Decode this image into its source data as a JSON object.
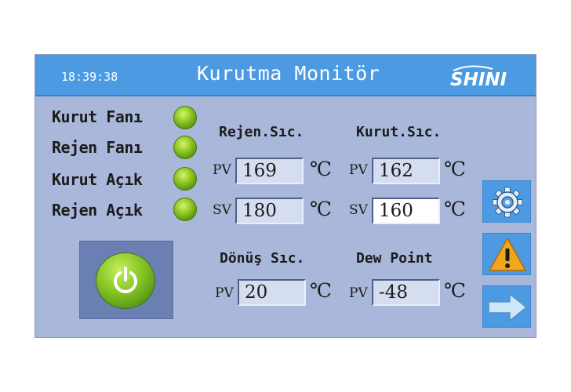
{
  "header": {
    "time": "18:39:38",
    "title": "Kurutma Monitör",
    "logo_text": "SHINI"
  },
  "status": [
    {
      "label": "Kurut Fanı",
      "state": "on",
      "color": "#8cc621"
    },
    {
      "label": "Rejen Fanı",
      "state": "on",
      "color": "#8cc621"
    },
    {
      "label": "Kurut Açık",
      "state": "on",
      "color": "#8cc621"
    },
    {
      "label": "Rejen Açık",
      "state": "on",
      "color": "#8cc621"
    }
  ],
  "sections": {
    "rejen": {
      "title": "Rejen.Sıc.",
      "pv_label": "PV",
      "pv": "169",
      "sv_label": "SV",
      "sv": "180",
      "unit": "℃"
    },
    "kurut": {
      "title": "Kurut.Sıc.",
      "pv_label": "PV",
      "pv": "162",
      "sv_label": "SV",
      "sv": "160",
      "unit": "℃"
    },
    "donus": {
      "title": "Dönüş Sıc.",
      "pv_label": "PV",
      "pv": "20",
      "unit": "℃"
    },
    "dew": {
      "title": "Dew Point",
      "pv_label": "PV",
      "pv": "-48",
      "unit": "℃"
    }
  },
  "side_buttons": [
    {
      "icon": "gear-icon"
    },
    {
      "icon": "warning-icon"
    },
    {
      "icon": "arrow-right-icon"
    }
  ],
  "power_button": {
    "icon": "power-icon"
  },
  "colors": {
    "header": "#4c9be2",
    "panel": "#a9b8da",
    "led": "#8cc621"
  }
}
